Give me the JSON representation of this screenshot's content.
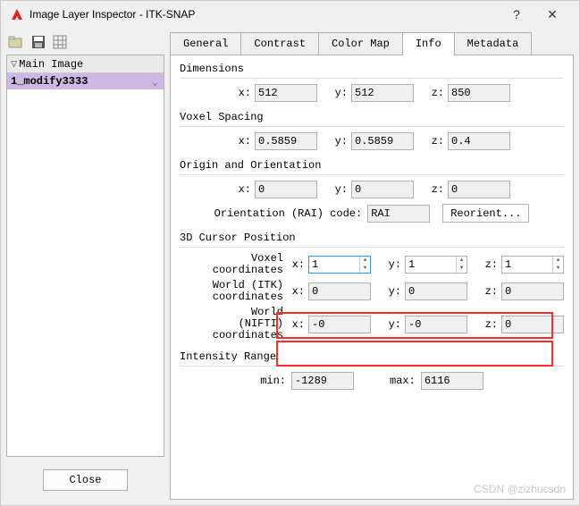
{
  "window": {
    "title": "Image Layer Inspector - ITK-SNAP"
  },
  "sidebar": {
    "header": "Main Image",
    "selected": "1_modify3333"
  },
  "close_label": "Close",
  "tabs": [
    "General",
    "Contrast",
    "Color Map",
    "Info",
    "Metadata"
  ],
  "active_tab": "Info",
  "sections": {
    "dimensions": {
      "title": "Dimensions",
      "x": "512",
      "y": "512",
      "z": "850"
    },
    "voxel_spacing": {
      "title": "Voxel Spacing",
      "x": "0.5859",
      "y": "0.5859",
      "z": "0.4"
    },
    "origin": {
      "title": "Origin and Orientation",
      "x": "0",
      "y": "0",
      "z": "0",
      "code_label": "Orientation (RAI) code:",
      "code": "RAI",
      "reorient_label": "Reorient..."
    },
    "cursor": {
      "title": "3D Cursor Position",
      "voxel_label": "Voxel\ncoordinates",
      "voxel": {
        "x": "1",
        "y": "1",
        "z": "1"
      },
      "itk_label": "World (ITK)\ncoordinates",
      "itk": {
        "x": "0",
        "y": "0",
        "z": "0"
      },
      "nifti_label": "World\n(NIFTI)\ncoordinates",
      "nifti": {
        "x": "-0",
        "y": "-0",
        "z": "0"
      }
    },
    "intensity": {
      "title": "Intensity Range",
      "min_label": "min:",
      "min": "-1289",
      "max_label": "max:",
      "max": "6116"
    }
  },
  "labels": {
    "x": "x:",
    "y": "y:",
    "z": "z:"
  },
  "watermark": "CSDN @zizhucsdn"
}
